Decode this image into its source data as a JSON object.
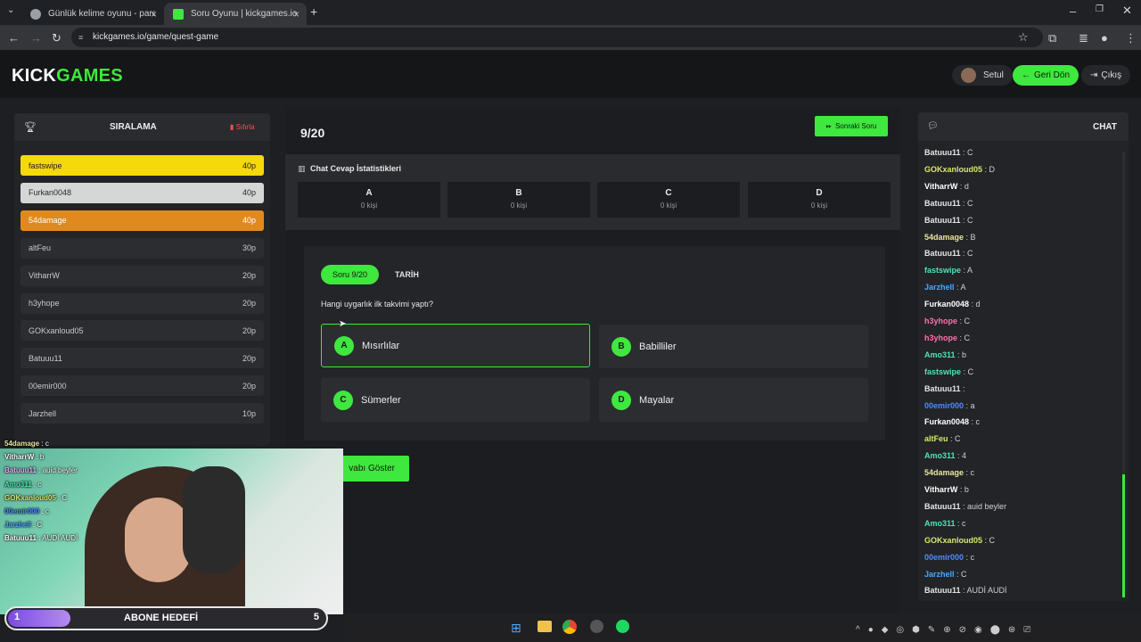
{
  "browser": {
    "tabs": [
      {
        "title": "Günlük kelime oyunu - parolla",
        "active": false
      },
      {
        "title": "Soru Oyunu | kickgames.io",
        "active": true
      }
    ],
    "url": "kickgames.io/game/quest-game"
  },
  "header": {
    "logo_kick": "KICK",
    "logo_games": "GAMES",
    "user": "Setul",
    "back_label": "Geri Dön",
    "logout_label": "Çıkış"
  },
  "leaderboard": {
    "title": "SIRALAMA",
    "reset_label": "Sıfırla",
    "rows": [
      {
        "name": "fastswipe",
        "score": "40p"
      },
      {
        "name": "Furkan0048",
        "score": "40p"
      },
      {
        "name": "54damage",
        "score": "40p"
      },
      {
        "name": "altFeu",
        "score": "30p"
      },
      {
        "name": "VitharrW",
        "score": "20p"
      },
      {
        "name": "h3yhope",
        "score": "20p"
      },
      {
        "name": "GOKxanloud05",
        "score": "20p"
      },
      {
        "name": "Batuuu11",
        "score": "20p"
      },
      {
        "name": "00emir000",
        "score": "20p"
      },
      {
        "name": "Jarzhell",
        "score": "10p"
      }
    ]
  },
  "game": {
    "progress": "9/20",
    "next_label": "Sonraki Soru",
    "stats_title": "Chat Cevap İstatistikleri",
    "stats": [
      {
        "letter": "A",
        "count": "0 kişi"
      },
      {
        "letter": "B",
        "count": "0 kişi"
      },
      {
        "letter": "C",
        "count": "0 kişi"
      },
      {
        "letter": "D",
        "count": "0 kişi"
      }
    ],
    "question_badge": "Soru 9/20",
    "category": "TARİH",
    "question": "Hangi uygarlık ilk takvimi yaptı?",
    "options": [
      {
        "letter": "A",
        "text": "Mısırlılar"
      },
      {
        "letter": "B",
        "text": "Babilliler"
      },
      {
        "letter": "C",
        "text": "Sümerler"
      },
      {
        "letter": "D",
        "text": "Mayalar"
      }
    ],
    "show_answer_label": "vabı Göster"
  },
  "chat": {
    "title": "CHAT",
    "messages": [
      {
        "user": "Batuuu11",
        "text": "C",
        "color": "#e6e6e6"
      },
      {
        "user": "GOKxanloud05",
        "text": "D",
        "color": "#d9e86a"
      },
      {
        "user": "VitharrW",
        "text": "d",
        "color": "#ffffff"
      },
      {
        "user": "Batuuu11",
        "text": "C",
        "color": "#e6e6e6"
      },
      {
        "user": "Batuuu11",
        "text": "C",
        "color": "#e6e6e6"
      },
      {
        "user": "54damage",
        "text": "B",
        "color": "#e8e6a0"
      },
      {
        "user": "Batuuu11",
        "text": "C",
        "color": "#e6e6e6"
      },
      {
        "user": "fastswipe",
        "text": "A",
        "color": "#4fe3b0"
      },
      {
        "user": "Jarzhell",
        "text": "A",
        "color": "#4aa8ff"
      },
      {
        "user": "Furkan0048",
        "text": "d",
        "color": "#ffffff"
      },
      {
        "user": "h3yhope",
        "text": "C",
        "color": "#ff6fae"
      },
      {
        "user": "h3yhope",
        "text": "C",
        "color": "#ff6fae"
      },
      {
        "user": "Amo311",
        "text": "b",
        "color": "#4fe3b0"
      },
      {
        "user": "fastswipe",
        "text": "C",
        "color": "#4fe3b0"
      },
      {
        "user": "Batuuu11",
        "text": "",
        "color": "#e6e6e6"
      },
      {
        "user": "00emir000",
        "text": "a",
        "color": "#4a8cff"
      },
      {
        "user": "Furkan0048",
        "text": "c",
        "color": "#ffffff"
      },
      {
        "user": "altFeu",
        "text": "C",
        "color": "#d9e86a"
      },
      {
        "user": "Amo311",
        "text": "4",
        "color": "#4fe3b0"
      },
      {
        "user": "54damage",
        "text": "c",
        "color": "#e8e6a0"
      },
      {
        "user": "VitharrW",
        "text": "b",
        "color": "#ffffff"
      },
      {
        "user": "Batuuu11",
        "text": "auid beyler",
        "color": "#e6e6e6"
      },
      {
        "user": "Amo311",
        "text": "c",
        "color": "#4fe3b0"
      },
      {
        "user": "GOKxanloud05",
        "text": "C",
        "color": "#d9e86a"
      },
      {
        "user": "00emir000",
        "text": "c",
        "color": "#4a8cff"
      },
      {
        "user": "Jarzhell",
        "text": "C",
        "color": "#4aa8ff"
      },
      {
        "user": "Batuuu11",
        "text": "AUDİ AUDİ",
        "color": "#e6e6e6"
      }
    ]
  },
  "stream_overlay": {
    "chat": [
      {
        "user": "54damage",
        "text": "c",
        "color": "#e8e6a0"
      },
      {
        "user": "VitharrW",
        "text": "b",
        "color": "#ffffff"
      },
      {
        "user": "Batuuu11",
        "text": "auid beyler",
        "color": "#e6b0ff"
      },
      {
        "user": "Amo311",
        "text": "c",
        "color": "#4fe3b0"
      },
      {
        "user": "GOKxanloud05",
        "text": "C",
        "color": "#d9e86a"
      },
      {
        "user": "00emir000",
        "text": "c",
        "color": "#4a8cff"
      },
      {
        "user": "Jarzhell",
        "text": "C",
        "color": "#4aa8ff"
      },
      {
        "user": "Batuuu11",
        "text": "AUDİ AUDİ",
        "color": "#ffffff"
      }
    ],
    "goal_label": "ABONE HEDEFİ",
    "goal_current": "1",
    "goal_target": "5"
  },
  "colors": {
    "accent": "#3ee83e",
    "gold": "#f5d90a",
    "silver": "#d6d6d6",
    "bronze": "#e08a1e"
  }
}
